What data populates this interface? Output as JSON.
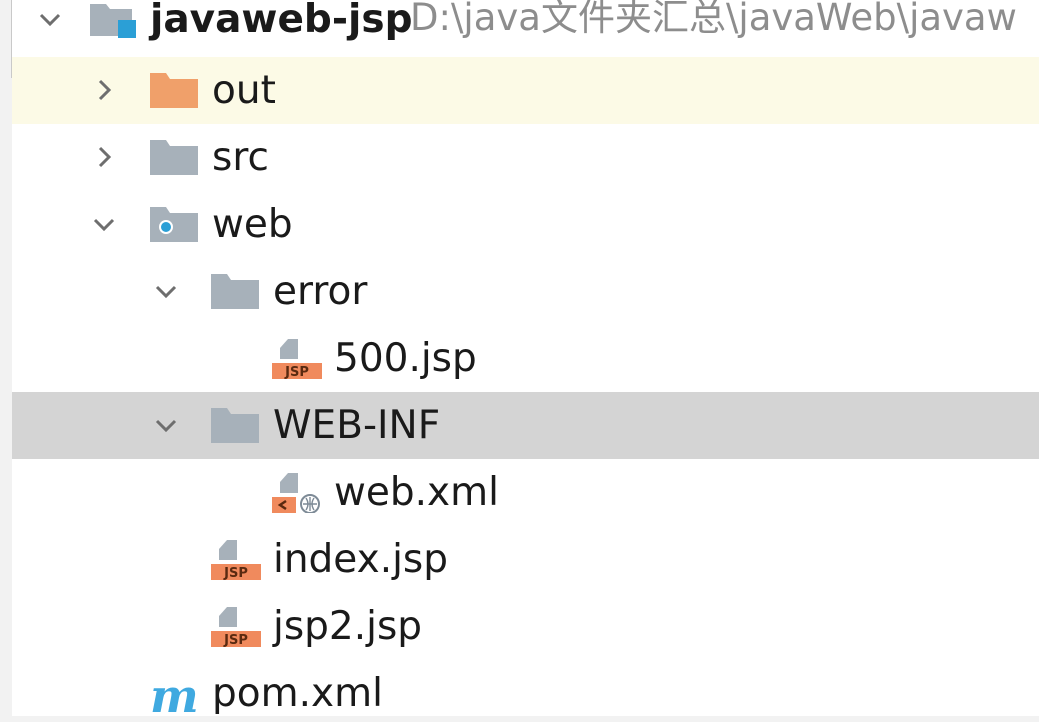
{
  "tree": {
    "root": {
      "name": "javaweb-jsp",
      "path": "D:\\java文件夹汇总\\javaWeb\\javaw",
      "expanded": true,
      "icon": "module-folder-icon"
    },
    "items": [
      {
        "name": "out",
        "icon": "excluded-folder-icon",
        "expanded": false,
        "color": "#f0a06a"
      },
      {
        "name": "src",
        "icon": "folder-icon",
        "expanded": false
      },
      {
        "name": "web",
        "icon": "web-folder-icon",
        "expanded": true
      },
      {
        "name": "error",
        "icon": "folder-icon",
        "expanded": true
      },
      {
        "name": "500.jsp",
        "icon": "jsp-file-icon"
      },
      {
        "name": "WEB-INF",
        "icon": "folder-icon",
        "expanded": true,
        "selected": true
      },
      {
        "name": "web.xml",
        "icon": "xml-config-file-icon"
      },
      {
        "name": "index.jsp",
        "icon": "jsp-file-icon"
      },
      {
        "name": "jsp2.jsp",
        "icon": "jsp-file-icon"
      },
      {
        "name": "pom.xml",
        "icon": "maven-icon"
      }
    ],
    "jsp_badge": "JSP",
    "colors": {
      "highlight_row": "#fcfae6",
      "selected_row": "#d4d4d4",
      "folder_gray": "#a7b1ba",
      "jsp_orange": "#f08a5d",
      "module_blue": "#2b9fd6",
      "maven_blue": "#3fa9e0"
    }
  }
}
